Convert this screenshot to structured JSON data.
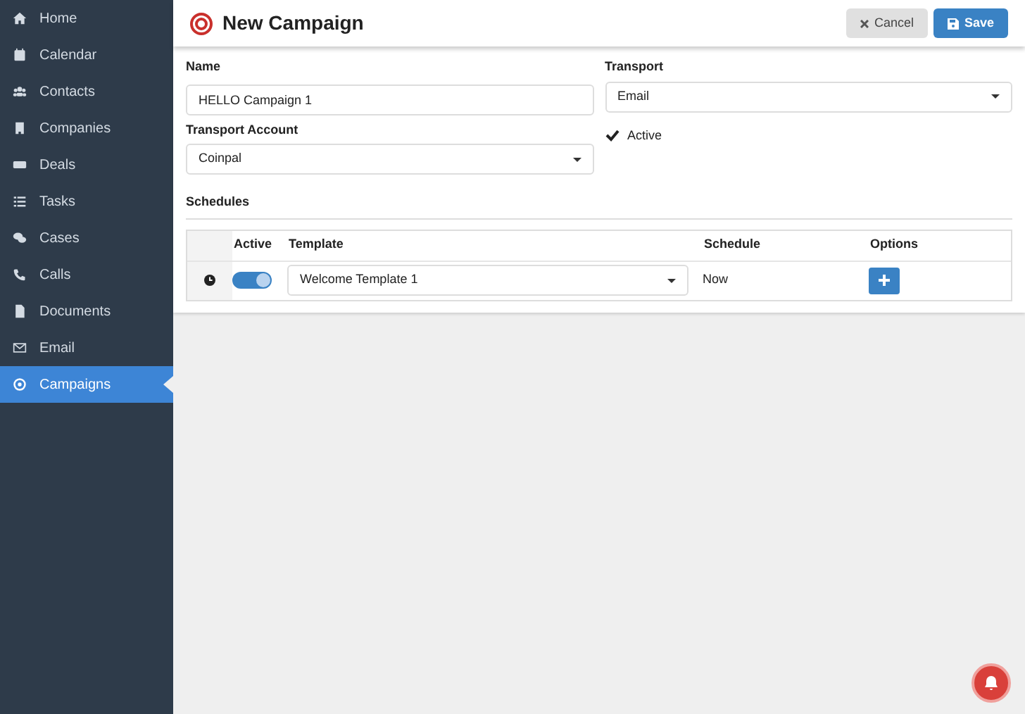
{
  "sidebar": {
    "items": [
      {
        "label": "Home",
        "selected": false
      },
      {
        "label": "Calendar",
        "selected": false
      },
      {
        "label": "Contacts",
        "selected": false
      },
      {
        "label": "Companies",
        "selected": false
      },
      {
        "label": "Deals",
        "selected": false
      },
      {
        "label": "Tasks",
        "selected": false
      },
      {
        "label": "Cases",
        "selected": false
      },
      {
        "label": "Calls",
        "selected": false
      },
      {
        "label": "Documents",
        "selected": false
      },
      {
        "label": "Email",
        "selected": false
      },
      {
        "label": "Campaigns",
        "selected": true
      }
    ]
  },
  "header": {
    "title": "New Campaign",
    "buttons": [
      {
        "label": "Cancel",
        "kind": "cancel"
      },
      {
        "label": "Save",
        "kind": "save"
      }
    ]
  },
  "form": {
    "name": {
      "label": "Name",
      "value": "HELLO Campaign 1"
    },
    "transport": {
      "label": "Transport",
      "value": "Email"
    },
    "transport_account": {
      "label": "Transport Account",
      "value": "Coinpal"
    },
    "active": {
      "label": "Active",
      "checked": true
    }
  },
  "schedules": {
    "title": "Schedules",
    "columns": [
      "Active",
      "Template",
      "Schedule",
      "Options"
    ],
    "rows": [
      {
        "on": true,
        "template": "Welcome Template 1",
        "schedule": "Now"
      }
    ]
  }
}
